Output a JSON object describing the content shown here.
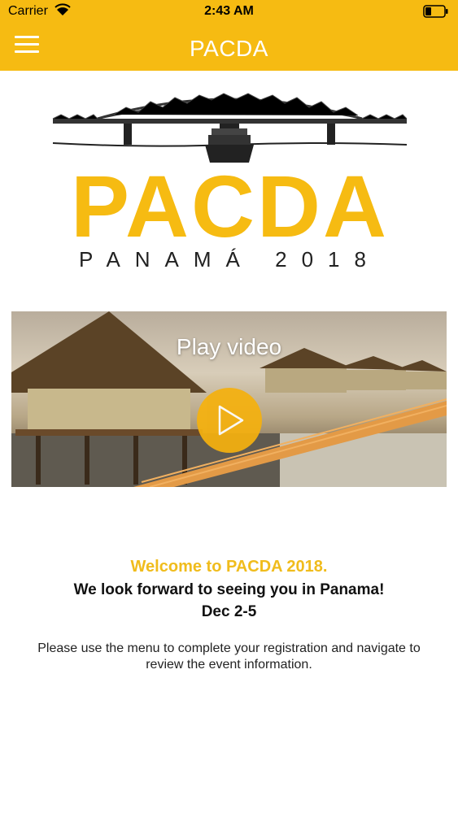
{
  "status_bar": {
    "carrier": "Carrier",
    "time": "2:43 AM",
    "wifi_icon": "wifi-icon",
    "battery_icon": "battery-icon"
  },
  "nav": {
    "title": "PACDA",
    "menu_icon": "hamburger-menu-icon",
    "color": "#F6BB12"
  },
  "logo": {
    "word": "PACDA",
    "subtitle": "PANAMÁ 2018",
    "graphic": "bridge-and-ship-illustration"
  },
  "video": {
    "label": "Play video",
    "play_icon": "play-icon",
    "accent_color": "#F5B10F"
  },
  "content": {
    "welcome": "Welcome to PACDA 2018.",
    "tagline": "We look forward to seeing you in Panama!",
    "dates": "Dec 2-5",
    "info": "Please use the menu to complete your registration and navigate to review the event information."
  }
}
